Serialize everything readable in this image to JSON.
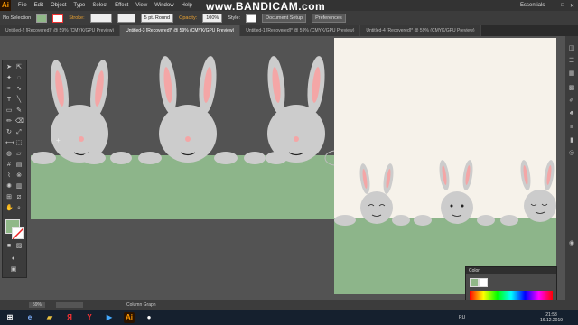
{
  "app": {
    "logo": "Ai",
    "watermark": "www.BANDICAM.com",
    "workspace": "Essentials"
  },
  "menu": [
    "File",
    "Edit",
    "Object",
    "Type",
    "Select",
    "Effect",
    "View",
    "Window",
    "Help"
  ],
  "controls": {
    "selection": "No Selection",
    "stroke_label": "Stroke:",
    "brush": "5 pt. Round",
    "opacity_label": "Opacity:",
    "opacity_value": "100%",
    "style_label": "Style:",
    "doc_setup": "Document Setup",
    "preferences": "Preferences"
  },
  "tabs": [
    "Untitled-2 [Recovered]* @ 59% (CMYK/GPU Preview)",
    "Untitled-3 [Recovered]* @ 59% (CMYK/GPU Preview)",
    "Untitled-1 [Recovered]* @ 59% (CMYK/GPU Preview)",
    "Untitled-4 [Recovered]* @ 59% (CMYK/GPU Preview)"
  ],
  "color_panel": {
    "title": "Color"
  },
  "status": {
    "zoom": "59%",
    "tool": "Column Graph"
  },
  "taskbar": {
    "lang": "RU",
    "time": "21:53",
    "date": "16.12.2019"
  },
  "colors": {
    "fill": "#90b888",
    "bunny": "#cccccc",
    "ear": "#f4a6a6",
    "grass": "#8db58a",
    "artboard": "#f6f2ea"
  }
}
